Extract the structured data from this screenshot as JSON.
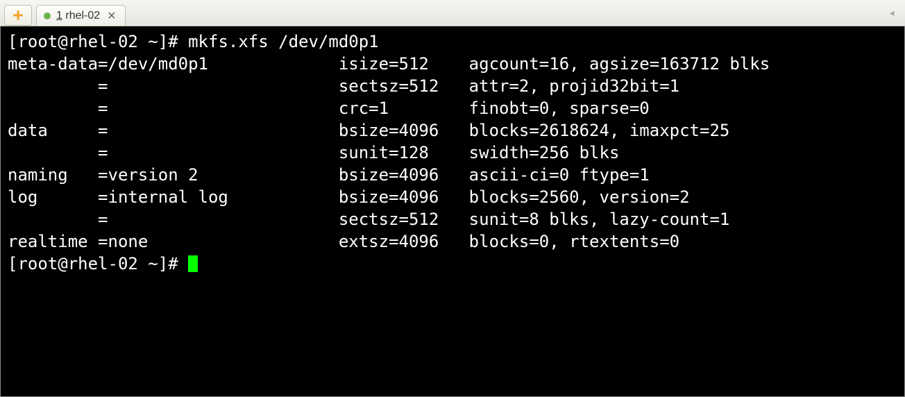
{
  "tabs": {
    "active": {
      "index": "1",
      "title": "rhel-02",
      "status": "connected"
    }
  },
  "terminal": {
    "prompt": "[root@rhel-02 ~]# ",
    "command": "mkfs.xfs /dev/md0p1",
    "output": "meta-data=/dev/md0p1             isize=512    agcount=16, agsize=163712 blks\n         =                       sectsz=512   attr=2, projid32bit=1\n         =                       crc=1        finobt=0, sparse=0\ndata     =                       bsize=4096   blocks=2618624, imaxpct=25\n         =                       sunit=128    swidth=256 blks\nnaming   =version 2              bsize=4096   ascii-ci=0 ftype=1\nlog      =internal log           bsize=4096   blocks=2560, version=2\n         =                       sectsz=512   sunit=8 blks, lazy-count=1\nrealtime =none                   extsz=4096   blocks=0, rtextents=0",
    "prompt2": "[root@rhel-02 ~]# "
  }
}
